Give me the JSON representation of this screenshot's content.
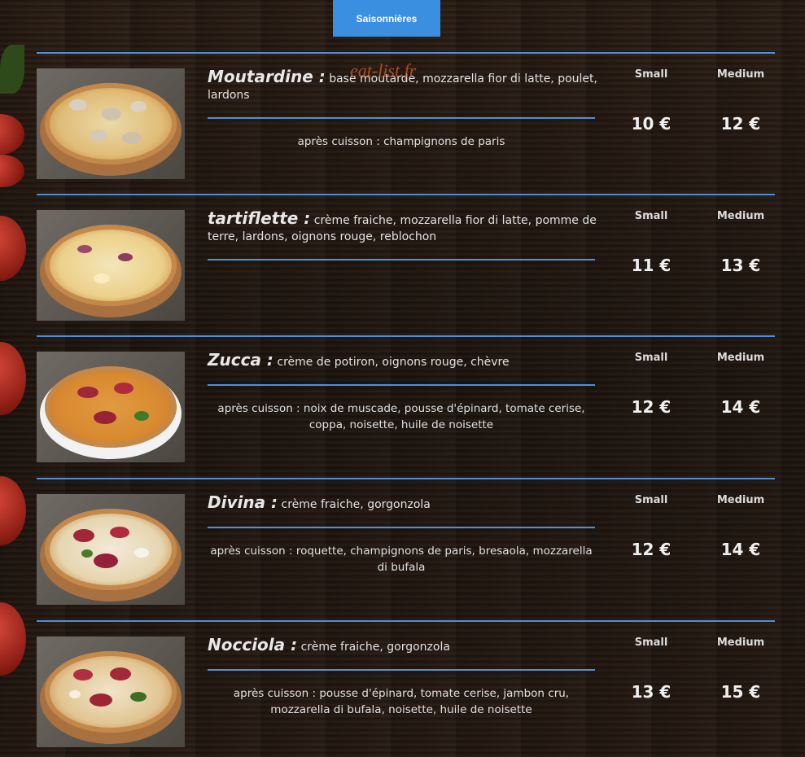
{
  "tab": {
    "label": "Saisonnières"
  },
  "watermark": "eat-list.fr",
  "items": [
    {
      "name": "Moutardine :",
      "ingredients": "base moutarde, mozzarella fior di latte, poulet, lardons",
      "after": "après cuisson : champignons de paris",
      "small_label": "Small",
      "medium_label": "Medium",
      "small_price": "10 €",
      "medium_price": "12 €"
    },
    {
      "name": "tartiflette :",
      "ingredients": "crème fraiche, mozzarella fior di latte, pomme de terre, lardons, oignons rouge, reblochon",
      "after": "",
      "small_label": "Small",
      "medium_label": "Medium",
      "small_price": "11 €",
      "medium_price": "13 €"
    },
    {
      "name": "Zucca :",
      "ingredients": "crème de potiron, oignons rouge, chèvre",
      "after": "après cuisson : noix de muscade, pousse d'épinard, tomate cerise, coppa, noisette, huile de noisette",
      "small_label": "Small",
      "medium_label": "Medium",
      "small_price": "12 €",
      "medium_price": "14 €"
    },
    {
      "name": "Divina :",
      "ingredients": "crème fraiche, gorgonzola",
      "after": "après cuisson : roquette, champignons de paris, bresaola, mozzarella di bufala",
      "small_label": "Small",
      "medium_label": "Medium",
      "small_price": "12 €",
      "medium_price": "14 €"
    },
    {
      "name": "Nocciola :",
      "ingredients": "crème fraiche, gorgonzola",
      "after": "après cuisson : pousse d'épinard, tomate cerise, jambon cru, mozzarella di bufala, noisette, huile de noisette",
      "small_label": "Small",
      "medium_label": "Medium",
      "small_price": "13 €",
      "medium_price": "15 €"
    }
  ]
}
